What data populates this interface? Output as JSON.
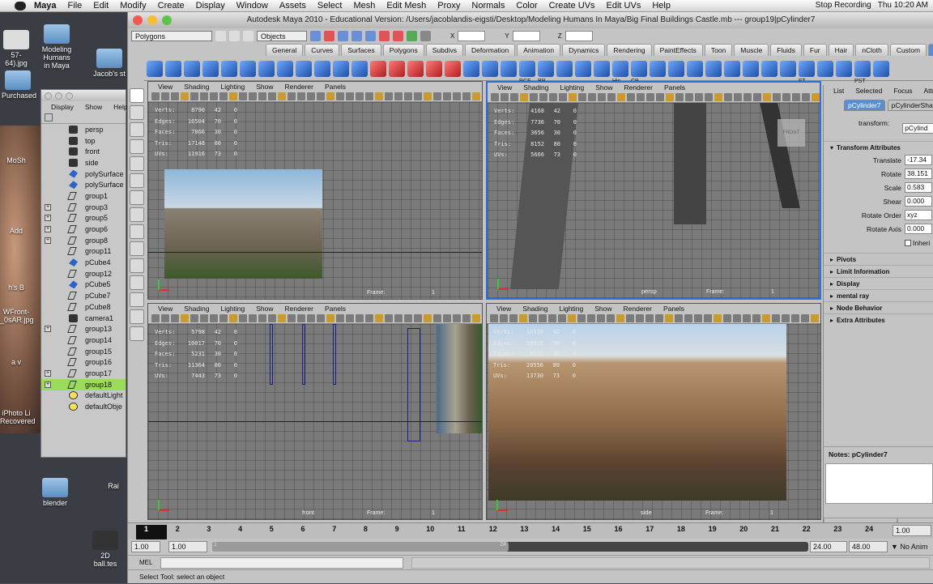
{
  "menubar": {
    "app": "Maya",
    "items": [
      "File",
      "Edit",
      "Modify",
      "Create",
      "Display",
      "Window",
      "Assets",
      "Select",
      "Mesh",
      "Edit Mesh",
      "Proxy",
      "Normals",
      "Color",
      "Create UVs",
      "Edit UVs",
      "Help"
    ],
    "recording": "Stop Recording",
    "clock": "Thu 10:20 AM"
  },
  "desktop": {
    "icons": [
      "Modeling Humans in Maya",
      "Jacob's st",
      "Purchased",
      "MoSh",
      "Add",
      "h's B",
      "WFront-_0sAR.jpg",
      "a v",
      "iPhoto Li Recovered",
      "Rai",
      "blender",
      "2D ball.tes",
      "57-64).jpg"
    ]
  },
  "outliner": {
    "menu": [
      "Display",
      "Show",
      "Help"
    ],
    "items": [
      {
        "label": "persp",
        "type": "cam",
        "exp": false,
        "sel": false
      },
      {
        "label": "top",
        "type": "cam",
        "exp": false,
        "sel": false
      },
      {
        "label": "front",
        "type": "cam",
        "exp": false,
        "sel": false
      },
      {
        "label": "side",
        "type": "cam",
        "exp": false,
        "sel": false
      },
      {
        "label": "polySurface",
        "type": "mesh",
        "exp": false,
        "sel": false
      },
      {
        "label": "polySurface",
        "type": "mesh",
        "exp": false,
        "sel": false
      },
      {
        "label": "group1",
        "type": "grp",
        "exp": false,
        "sel": false
      },
      {
        "label": "group3",
        "type": "grp",
        "exp": true,
        "sel": false
      },
      {
        "label": "group5",
        "type": "grp",
        "exp": true,
        "sel": false
      },
      {
        "label": "group6",
        "type": "grp",
        "exp": true,
        "sel": false
      },
      {
        "label": "group8",
        "type": "grp",
        "exp": true,
        "sel": false
      },
      {
        "label": "group11",
        "type": "grp",
        "exp": false,
        "sel": false
      },
      {
        "label": "pCube4",
        "type": "mesh",
        "exp": false,
        "sel": false
      },
      {
        "label": "group12",
        "type": "grp",
        "exp": false,
        "sel": false
      },
      {
        "label": "pCube5",
        "type": "mesh",
        "exp": false,
        "sel": false
      },
      {
        "label": "pCube7",
        "type": "grp",
        "exp": false,
        "sel": false
      },
      {
        "label": "pCube8",
        "type": "grp",
        "exp": false,
        "sel": false
      },
      {
        "label": "camera1",
        "type": "cam",
        "exp": false,
        "sel": false
      },
      {
        "label": "group13",
        "type": "grp",
        "exp": true,
        "sel": false
      },
      {
        "label": "group14",
        "type": "grp",
        "exp": false,
        "sel": false
      },
      {
        "label": "group15",
        "type": "grp",
        "exp": false,
        "sel": false
      },
      {
        "label": "group16",
        "type": "grp",
        "exp": false,
        "sel": false
      },
      {
        "label": "group17",
        "type": "grp",
        "exp": true,
        "sel": false
      },
      {
        "label": "group18",
        "type": "grp",
        "exp": true,
        "sel": true
      },
      {
        "label": "defaultLight",
        "type": "light",
        "exp": false,
        "sel": false
      },
      {
        "label": "defaultObje",
        "type": "light",
        "exp": false,
        "sel": false
      }
    ]
  },
  "window": {
    "title": "Autodesk Maya 2010 - Educational Version: /Users/jacoblandis-eigsti/Desktop/Modeling Humans In Maya/Big Final Buildings Castle.mb  ---  group19|pCylinder7",
    "menuset": "Polygons",
    "select_mode": "Objects",
    "xyz": [
      "X",
      "Y",
      "Z"
    ]
  },
  "shelf_tabs": [
    "General",
    "Curves",
    "Surfaces",
    "Polygons",
    "Subdivs",
    "Deformation",
    "Animation",
    "Dynamics",
    "Rendering",
    "PaintEffects",
    "Toon",
    "Muscle",
    "Fluids",
    "Fur",
    "Hair",
    "nCloth",
    "Custom",
    "Stuff_I_Use"
  ],
  "shelf_labels": [
    "RCF",
    "BR",
    "His",
    "CP",
    "FT",
    "PST"
  ],
  "panel_menu": [
    "View",
    "Shading",
    "Lighting",
    "Show",
    "Renderer",
    "Panels"
  ],
  "hud_keys": [
    "Verts:",
    "Edges:",
    "Faces:",
    "Tris:",
    "UVs:"
  ],
  "panes": [
    {
      "name": "top",
      "stats": [
        [
          "8790",
          "42",
          "0"
        ],
        [
          "16504",
          "70",
          "0"
        ],
        [
          "7866",
          "30",
          "0"
        ],
        [
          "17148",
          "80",
          "0"
        ],
        [
          "11916",
          "73",
          "0"
        ]
      ],
      "frame_label": "Frame:",
      "frame": "1",
      "camera": ""
    },
    {
      "name": "persp",
      "stats": [
        [
          "4168",
          "42",
          "0"
        ],
        [
          "7736",
          "70",
          "0"
        ],
        [
          "3656",
          "30",
          "0"
        ],
        [
          "8152",
          "80",
          "0"
        ],
        [
          "5666",
          "73",
          "0"
        ]
      ],
      "frame_label": "Frame:",
      "frame": "1",
      "camera": "persp"
    },
    {
      "name": "front",
      "stats": [
        [
          "5798",
          "42",
          "0"
        ],
        [
          "10017",
          "70",
          "0"
        ],
        [
          "5231",
          "30",
          "0"
        ],
        [
          "11364",
          "80",
          "0"
        ],
        [
          "7443",
          "73",
          "0"
        ]
      ],
      "frame_label": "Frame:",
      "frame": "1",
      "camera": "front"
    },
    {
      "name": "side",
      "stats": [
        [
          "10510",
          "42",
          "0"
        ],
        [
          "19915",
          "70",
          "0"
        ],
        [
          "9573",
          "30",
          "0"
        ],
        [
          "20556",
          "80",
          "0"
        ],
        [
          "13730",
          "73",
          "0"
        ]
      ],
      "frame_label": "Frame:",
      "frame": "1",
      "camera": "side"
    }
  ],
  "view_cube": "FRONT",
  "attr": {
    "tabs": [
      "List",
      "Selected",
      "Focus",
      "Attribu"
    ],
    "node_tabs": [
      "pCylinder7",
      "pCylinderSha"
    ],
    "transform_label": "transform:",
    "transform_value": "pCylind",
    "section": "Transform Attributes",
    "rows": [
      {
        "label": "Translate",
        "value": "-17.34"
      },
      {
        "label": "Rotate",
        "value": "38.151"
      },
      {
        "label": "Scale",
        "value": "0.583"
      },
      {
        "label": "Shear",
        "value": "0.000"
      },
      {
        "label": "Rotate Order",
        "value": "xyz"
      },
      {
        "label": "Rotate Axis",
        "value": "0.000"
      }
    ],
    "inherit": "Inheri",
    "sections": [
      "Pivots",
      "Limit Information",
      "Display",
      "mental ray",
      "Node Behavior",
      "Extra Attributes"
    ],
    "notes": "Notes:  pCylinder7",
    "buttons": [
      "Select",
      "Load"
    ]
  },
  "timeline": {
    "ticks": [
      "1",
      "2",
      "3",
      "4",
      "5",
      "6",
      "7",
      "8",
      "9",
      "10",
      "11",
      "12",
      "13",
      "14",
      "15",
      "16",
      "17",
      "18",
      "19",
      "20",
      "21",
      "22",
      "23",
      "24"
    ],
    "current": "1.00",
    "start": "1.00",
    "start2": "1.00",
    "range_start_mark": "1",
    "range_end_mark": "24",
    "end": "24.00",
    "end2": "48.00",
    "anim": "No Anim"
  },
  "mel_label": "MEL",
  "help_line": "Select Tool: select an object",
  "colors": {
    "accent": "#2d6fd6",
    "selection": "#9bdb5a",
    "shelf_blue": "#2a63c9"
  }
}
